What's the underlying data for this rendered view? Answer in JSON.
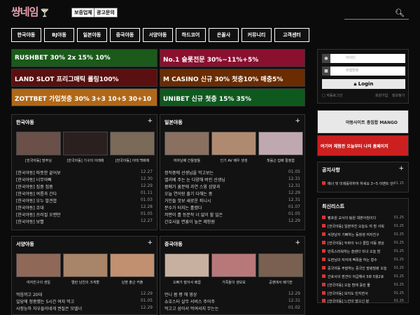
{
  "header": {
    "logo": "썅네임",
    "buttons": [
      "보증업체",
      "광고문의"
    ]
  },
  "nav": [
    "한국야동",
    "BJ야동",
    "일본야동",
    "중국야동",
    "서양야동",
    "하드코어",
    "은꼴사",
    "커뮤니티",
    "고객센터"
  ],
  "banners": [
    {
      "text": "RUSHBET 30% 2x 15% 10%",
      "color": "#1b5a1b"
    },
    {
      "text": "No.1 슬롯전문 30%~11%+5%",
      "color": "#8a1030"
    },
    {
      "text": "LAND SLOT 프리그매틱 롤링100%",
      "color": "#5a1010"
    },
    {
      "text": "M CASINO 신규 30% 첫충10% 매충5%",
      "color": "#6a2c00"
    },
    {
      "text": "ZOTTBET 가입첫충 30% 3+3 10+5 30+10",
      "color": "#b06818"
    },
    {
      "text": "UNIBET 신규 첫충 15% 35%",
      "color": "#0e5a1e"
    }
  ],
  "login": {
    "id_placeholder": "아이디",
    "pw_placeholder": "비밀번호",
    "button": "Login",
    "remember": "자동로그인",
    "signup": "회원가입",
    "find": "정보찾기"
  },
  "side_banners": [
    {
      "text": "야동사이트 총집합 MANGO",
      "color": "#e8e8e8"
    },
    {
      "text": "여기여 체험판 오늘부터 나의 홈페이지",
      "color": "#cc2020"
    }
  ],
  "notice": {
    "title": "공지사항",
    "items": [
      {
        "text": "메너 및 미래를위하여 하세요 3~5 이벤트 안내",
        "date": "01.15"
      }
    ]
  },
  "latest": {
    "title": "최신리스트",
    "items": [
      {
        "text": "펌호원 교사의 팀원 대본아침이다",
        "date": "01.25"
      },
      {
        "text": "[한국야동] 일본여친 오늘도 여 밤 샤워",
        "date": "01.25"
      },
      {
        "text": "서양남자 기뻐하는 동창생 여자친구",
        "date": "01.25"
      },
      {
        "text": "[한국야동] 두바이 누나 클럽 야동 영상",
        "date": "01.25"
      },
      {
        "text": "만족스러워하는 슬렌더 미녀 오늘 밤",
        "date": "01.25"
      },
      {
        "text": "도련님의 자지에 팩폭을 하는 형수",
        "date": "01.25"
      },
      {
        "text": "중국야동 주말하는 중국인 말랑말랑 오늘",
        "date": "01.25"
      },
      {
        "text": "간호사의 편견이 저급해서 5화 5월2호",
        "date": "01.25"
      },
      {
        "text": "[한국야동] 오늘 밤에 흘린 물",
        "date": "01.25"
      },
      {
        "text": "[한국야동] 보지도 빈지면서",
        "date": "01.25"
      },
      {
        "text": "[한국야동] 느낀이 많으신 분",
        "date": "01.25"
      }
    ]
  },
  "sections": [
    {
      "title": "한국야동",
      "thumbs": [
        "[한국야동] 맘주님",
        "[한국야동] 기구의 아래에",
        "[한국야동] 이태 백배에"
      ],
      "items": [
        {
          "text": "[한국야동] 따뜻한 끝어보",
          "date": "12.27"
        },
        {
          "text": "[한국야동] 너무아빠",
          "date": "12.30"
        },
        {
          "text": "[한국야동] 집중 집중",
          "date": "12.29"
        },
        {
          "text": "[한국야동] 여름과 간다",
          "date": "01.11"
        },
        {
          "text": "[한국야동] 오누 발견합",
          "date": "01.03"
        },
        {
          "text": "[한국야동] 흐대",
          "date": "12.28"
        },
        {
          "text": "[한국야동] 쓰러질 오랜만",
          "date": "01.05"
        },
        {
          "text": "[한국야동] 보빨",
          "date": "12.27"
        }
      ]
    },
    {
      "title": "일본야동",
      "thumbs": [
        "여자남배 간들말들",
        "인기 AV 배우 생생",
        "첫음근 집배 절정함"
      ],
      "items": [
        {
          "text": "정직중에 선생님을 먹고보는",
          "date": "01.05"
        },
        {
          "text": "엘리베 주는 눈 다양해 버린 선생님",
          "date": "12.31"
        },
        {
          "text": "몸매가 흥분에 과연 스윙 섬맞과",
          "date": "12.31"
        },
        {
          "text": "오늘 연이랑 출기 다해는 중",
          "date": "12.29"
        },
        {
          "text": "거인들 맛보 새로운 피니시",
          "date": "12.31"
        },
        {
          "text": "분수가 터지는 흘렸다",
          "date": "01.07"
        },
        {
          "text": "저편이 흘 등문작 너 없이 할 일은",
          "date": "01.05"
        },
        {
          "text": "간호사들 면흥이 높은 제항원",
          "date": "12.29"
        }
      ]
    },
    {
      "title": "서양야동",
      "thumbs": [
        "여자친구의 생일",
        "엘런 남친의 크게할",
        "남편 출근 커플"
      ],
      "items": [
        {
          "text": "먹음까고 20대",
          "date": "12.29"
        },
        {
          "text": "일당에 정중했는 5시간 여자 먹고",
          "date": "01.05"
        },
        {
          "text": "사정능하 자우들이네게 권질은 모델너",
          "date": "12.29"
        }
      ]
    },
    {
      "title": "중국야동",
      "thumbs": [
        "오빠가 말아서 배꼽",
        "가족들이 생보보",
        "공영에서 배기한"
      ],
      "items": [
        {
          "text": "언니 몸 평 해 영상",
          "date": "12.29"
        },
        {
          "text": "쇼호스터 살무 서비스 주어주",
          "date": "12.31"
        },
        {
          "text": "먹고고 삼아서 먹여서지 무는는",
          "date": "01.02"
        }
      ]
    }
  ]
}
